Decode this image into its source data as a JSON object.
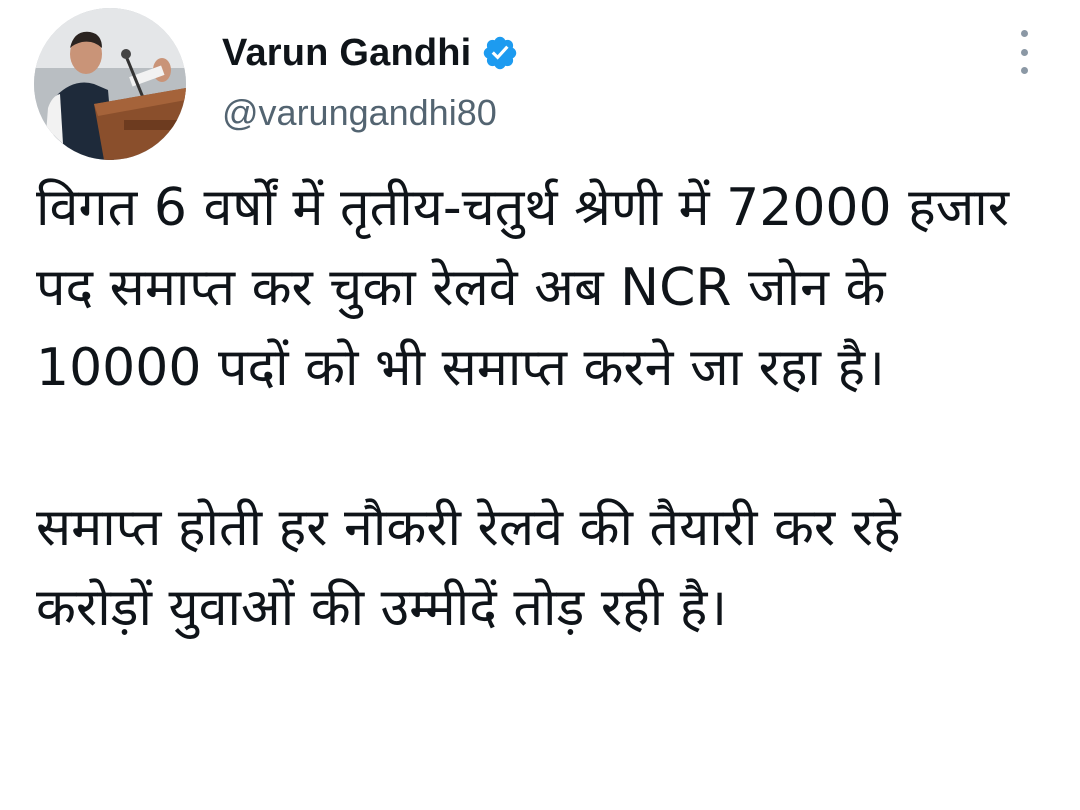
{
  "author": {
    "display_name": "Varun Gandhi",
    "handle": "@varungandhi80",
    "verified": true,
    "avatar_icon": "profile-photo-speaker-at-podium"
  },
  "menu": {
    "icon": "more-vertical-icon"
  },
  "colors": {
    "verified_badge": "#1d9bf0",
    "handle_text": "#536471",
    "body_text": "#0f1419"
  },
  "tweet": {
    "paragraphs": [
      "विगत 6 वर्षों में तृतीय-चतुर्थ श्रेणी में 72000 हजार पद समाप्त कर चुका रेलवे अब NCR जोन के 10000 पदों को भी समाप्त करने जा रहा है।",
      "समाप्त होती हर नौकरी रेलवे की तैयारी कर रहे करोड़ों युवाओं की उम्मीदें तोड़ रही है।"
    ]
  }
}
